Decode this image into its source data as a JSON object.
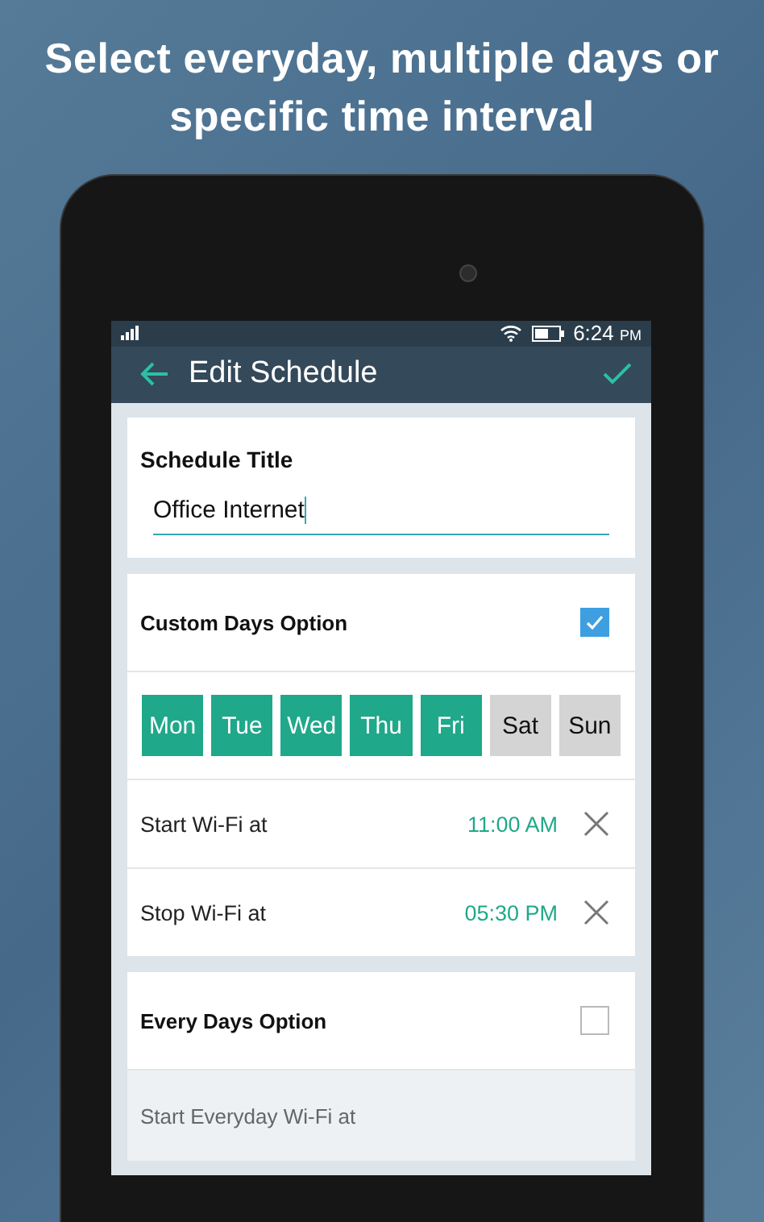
{
  "headline": "Select everyday, multiple days or specific time interval",
  "status_bar": {
    "time": "6:24",
    "meridiem": "PM"
  },
  "app_bar": {
    "title": "Edit Schedule"
  },
  "schedule_title": {
    "label": "Schedule Title",
    "value": "Office Internet"
  },
  "custom_days": {
    "label": "Custom Days Option",
    "checked": true,
    "days": [
      {
        "label": "Mon",
        "selected": true
      },
      {
        "label": "Tue",
        "selected": true
      },
      {
        "label": "Wed",
        "selected": true
      },
      {
        "label": "Thu",
        "selected": true
      },
      {
        "label": "Fri",
        "selected": true
      },
      {
        "label": "Sat",
        "selected": false
      },
      {
        "label": "Sun",
        "selected": false
      }
    ],
    "times": [
      {
        "label": "Start Wi-Fi at",
        "value": "11:00 AM"
      },
      {
        "label": "Stop Wi-Fi at",
        "value": "05:30 PM"
      }
    ]
  },
  "every_days": {
    "label": "Every Days Option",
    "checked": false,
    "rows": [
      {
        "label": "Start Everyday Wi-Fi at",
        "disabled": true
      }
    ]
  }
}
